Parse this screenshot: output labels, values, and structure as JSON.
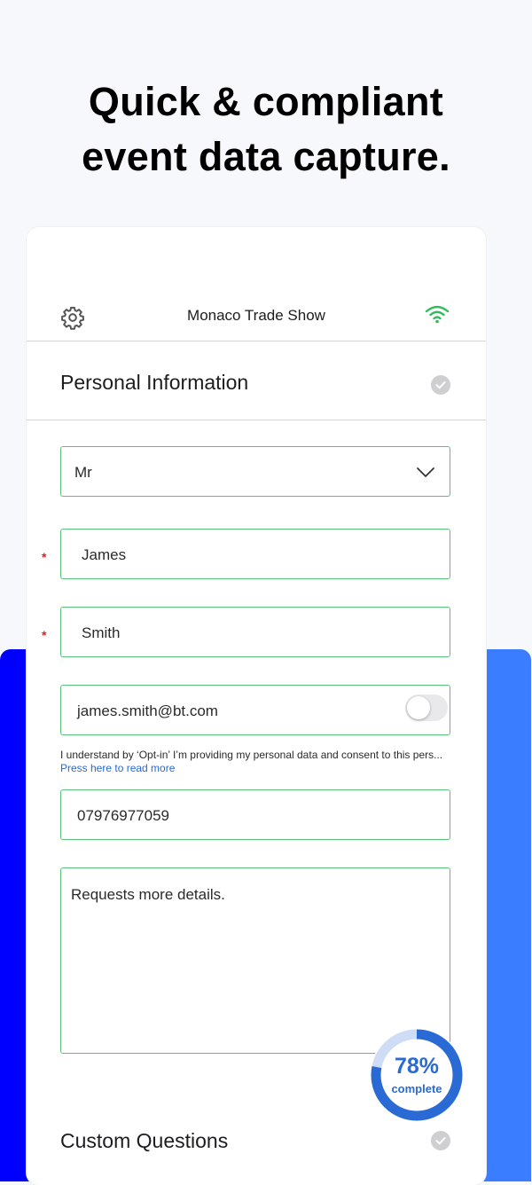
{
  "headline": {
    "line1": "Quick & compliant",
    "line2": "event data capture."
  },
  "topbar": {
    "event_name": "Monaco Trade Show",
    "settings_icon": "gear-icon",
    "status_icon": "wifi-icon"
  },
  "sections": [
    {
      "title": "Personal Information",
      "status_icon": "check-circle-icon"
    },
    {
      "title": "Custom Questions",
      "status_icon": "check-circle-icon"
    }
  ],
  "form": {
    "title_select": {
      "value": "Mr"
    },
    "first_name": {
      "value": "James",
      "required_mark": "*"
    },
    "last_name": {
      "value": "Smith",
      "required_mark": "*"
    },
    "email": {
      "value": "james.smith@bt.com",
      "opt_in": false
    },
    "consent": {
      "text": "I understand by ‘Opt-in’ I’m providing my personal data and consent to this pers...",
      "link": "Press here to read more"
    },
    "phone": {
      "value": "07976977059"
    },
    "notes": {
      "value": "Requests more details."
    }
  },
  "progress": {
    "percent_label": "78%",
    "label": "complete",
    "value": 0.78
  },
  "colors": {
    "accent": "#2a6ad4",
    "field_border": "#5ac17a",
    "wifi": "#2ebd59",
    "left_block": "#0000ff",
    "right_block": "#3a7dff"
  }
}
